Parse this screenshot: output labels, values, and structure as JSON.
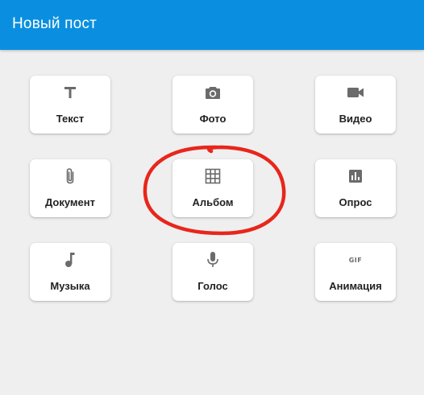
{
  "header": {
    "title": "Новый пост",
    "background_color": "#0a8fe0"
  },
  "options": [
    {
      "key": "text",
      "label": "Текст",
      "icon": "text-icon"
    },
    {
      "key": "photo",
      "label": "Фото",
      "icon": "camera-icon"
    },
    {
      "key": "video",
      "label": "Видео",
      "icon": "video-camera-icon"
    },
    {
      "key": "document",
      "label": "Документ",
      "icon": "paperclip-icon"
    },
    {
      "key": "album",
      "label": "Альбом",
      "icon": "grid-icon"
    },
    {
      "key": "poll",
      "label": "Опрос",
      "icon": "bar-chart-icon"
    },
    {
      "key": "music",
      "label": "Музыка",
      "icon": "music-note-icon"
    },
    {
      "key": "voice",
      "label": "Голос",
      "icon": "microphone-icon"
    },
    {
      "key": "animation",
      "label": "Анимация",
      "icon": "gif-icon",
      "icon_text": "GIF"
    }
  ],
  "highlight": {
    "target": "album",
    "color": "#e8261b"
  }
}
